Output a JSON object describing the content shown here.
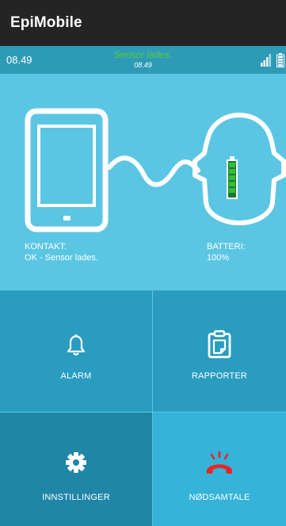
{
  "app": {
    "title": "EpiMobile"
  },
  "statusbar": {
    "time_left": "08.49",
    "status_text": "Sensor lades.",
    "status_time": "08.49"
  },
  "connection": {
    "contact_label": "KONTAKT:",
    "contact_value": "OK - Sensor lades.",
    "battery_label": "BATTERI:",
    "battery_value": "100%"
  },
  "tiles": [
    {
      "label": "ALARM",
      "icon": "bell-icon"
    },
    {
      "label": "RAPPORTER",
      "icon": "clipboard-icon"
    },
    {
      "label": "INNSTILLINGER",
      "icon": "gear-icon"
    },
    {
      "label": "NØDSAMTALE",
      "icon": "emergency-phone-icon"
    }
  ],
  "colors": {
    "titlebar": "#242424",
    "statusbar": "#2e9bb6",
    "panel": "#5bc6e3",
    "tile": "#2a9cc0",
    "tile_dark": "#1f86a8",
    "tile_light": "#35b3d8",
    "status_green": "#5acc3a",
    "emergency_red": "#e8262a",
    "battery_green": "#2fbf3b"
  }
}
